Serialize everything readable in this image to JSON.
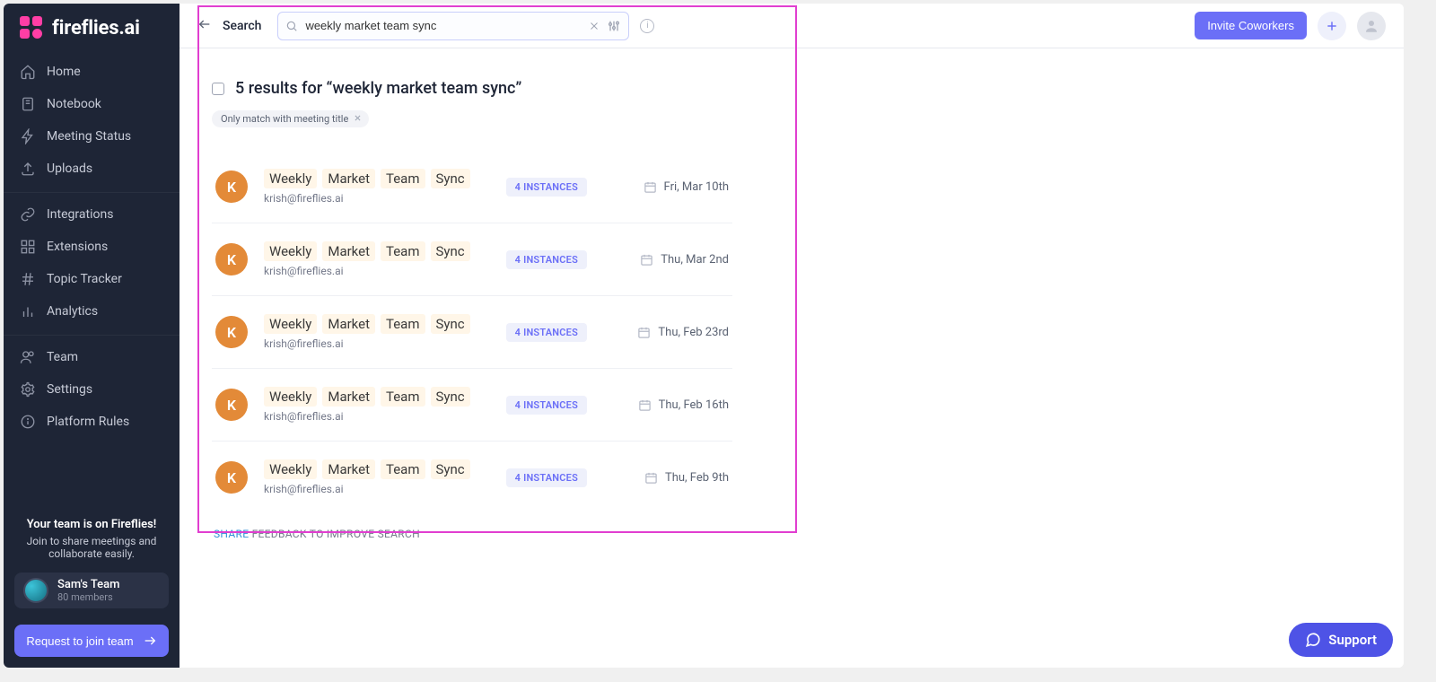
{
  "brand": {
    "name": "fireflies.ai"
  },
  "sidebar": {
    "items": [
      {
        "label": "Home"
      },
      {
        "label": "Notebook"
      },
      {
        "label": "Meeting Status"
      },
      {
        "label": "Uploads"
      },
      {
        "label": "Integrations"
      },
      {
        "label": "Extensions"
      },
      {
        "label": "Topic Tracker"
      },
      {
        "label": "Analytics"
      },
      {
        "label": "Team"
      },
      {
        "label": "Settings"
      },
      {
        "label": "Platform Rules"
      }
    ],
    "promo": {
      "title": "Your team is on Fireflies!",
      "subtitle": "Join to share meetings and collaborate easily."
    },
    "team_card": {
      "name": "Sam's Team",
      "members": "80 members"
    },
    "join_button": "Request to join team"
  },
  "topbar": {
    "title": "Search",
    "search_value": "weekly market team sync",
    "invite_label": "Invite Coworkers"
  },
  "search": {
    "results_count_text": "5 results for “weekly market team sync”",
    "filter_chip": "Only match with meeting title",
    "results": [
      {
        "avatar_letter": "K",
        "tokens": [
          "Weekly",
          "Market",
          "Team",
          "Sync"
        ],
        "owner": "krish@fireflies.ai",
        "instances": "4 INSTANCES",
        "date": "Fri, Mar 10th"
      },
      {
        "avatar_letter": "K",
        "tokens": [
          "Weekly",
          "Market",
          "Team",
          "Sync"
        ],
        "owner": "krish@fireflies.ai",
        "instances": "4 INSTANCES",
        "date": "Thu, Mar 2nd"
      },
      {
        "avatar_letter": "K",
        "tokens": [
          "Weekly",
          "Market",
          "Team",
          "Sync"
        ],
        "owner": "krish@fireflies.ai",
        "instances": "4 INSTANCES",
        "date": "Thu, Feb 23rd"
      },
      {
        "avatar_letter": "K",
        "tokens": [
          "Weekly",
          "Market",
          "Team",
          "Sync"
        ],
        "owner": "krish@fireflies.ai",
        "instances": "4 INSTANCES",
        "date": "Thu, Feb 16th"
      },
      {
        "avatar_letter": "K",
        "tokens": [
          "Weekly",
          "Market",
          "Team",
          "Sync"
        ],
        "owner": "krish@fireflies.ai",
        "instances": "4 INSTANCES",
        "date": "Thu, Feb 9th"
      }
    ],
    "feedback_share": "SHARE",
    "feedback_rest": " FEEDBACK TO IMPROVE SEARCH"
  },
  "support_button": "Support",
  "colors": {
    "sidebar_bg": "#1e2536",
    "accent": "#6b6ff7",
    "highlight": "#e13ed0",
    "avatar_orange": "#e38a38"
  }
}
